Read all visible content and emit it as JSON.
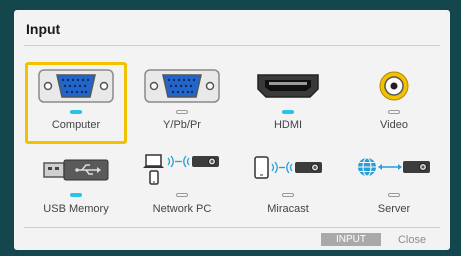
{
  "dialog": {
    "title": "Input"
  },
  "sources": [
    {
      "label": "Computer",
      "icon": "vga-port-icon",
      "active": true,
      "selected": true
    },
    {
      "label": "Y/Pb/Pr",
      "icon": "vga-port-icon",
      "active": false,
      "selected": false
    },
    {
      "label": "HDMI",
      "icon": "hdmi-port-icon",
      "active": true,
      "selected": false
    },
    {
      "label": "Video",
      "icon": "rca-video-port-icon",
      "active": false,
      "selected": false
    },
    {
      "label": "USB Memory",
      "icon": "usb-drive-icon",
      "active": true,
      "selected": false
    },
    {
      "label": "Network PC",
      "icon": "network-pc-icon",
      "active": false,
      "selected": false
    },
    {
      "label": "Miracast",
      "icon": "miracast-icon",
      "active": false,
      "selected": false
    },
    {
      "label": "Server",
      "icon": "server-globe-icon",
      "active": false,
      "selected": false
    }
  ],
  "footer": {
    "input_label": "INPUT",
    "close_label": "Close"
  },
  "colors": {
    "background": "#14464e",
    "panel": "#f3f3f3",
    "selection": "#f2c200",
    "active_indicator": "#29c4e6"
  }
}
